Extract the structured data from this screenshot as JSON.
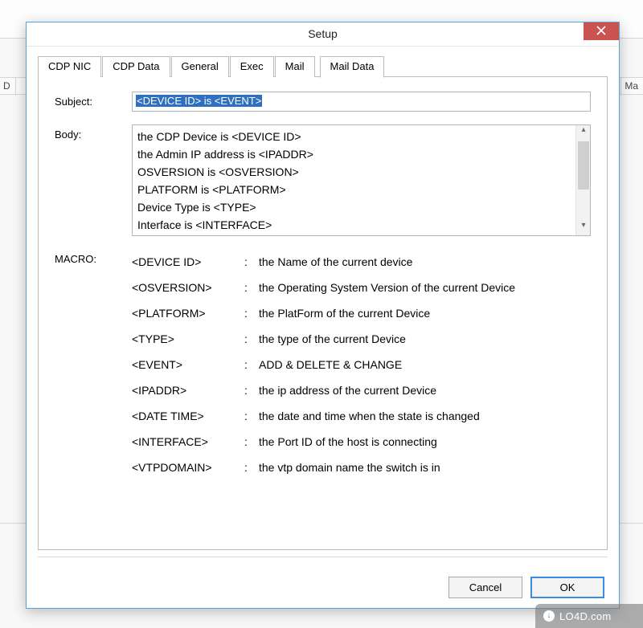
{
  "main_window": {
    "header_left": "D",
    "header_right": "Ma"
  },
  "dialog": {
    "title": "Setup",
    "close_glyph": "✕",
    "tabs": [
      {
        "label": "CDP NIC"
      },
      {
        "label": "CDP Data"
      },
      {
        "label": "General"
      },
      {
        "label": "Exec"
      },
      {
        "label": "Mail"
      },
      {
        "label": "Mail Data"
      }
    ],
    "active_tab_index": 5,
    "subject_label": "Subject:",
    "subject_value": "<DEVICE ID> is <EVENT>",
    "body_label": "Body:",
    "body_value": "the CDP Device is <DEVICE ID>\nthe Admin IP address is <IPADDR>\nOSVERSION is <OSVERSION>\nPLATFORM is <PLATFORM>\nDevice Type is <TYPE>\nInterface is <INTERFACE>",
    "macro_label": "MACRO:",
    "macros": [
      {
        "key": "<DEVICE ID>",
        "desc": "the Name of the current device"
      },
      {
        "key": "<OSVERSION>",
        "desc": "the Operating System Version of the current Device"
      },
      {
        "key": "<PLATFORM>",
        "desc": "the PlatForm of the current Device"
      },
      {
        "key": "<TYPE>",
        "desc": "the type of the current Device"
      },
      {
        "key": "<EVENT>",
        "desc": "ADD & DELETE & CHANGE"
      },
      {
        "key": "<IPADDR>",
        "desc": "the ip address of the current Device"
      },
      {
        "key": "<DATE TIME>",
        "desc": "the date and time when the state is changed"
      },
      {
        "key": "<INTERFACE>",
        "desc": "the Port ID of the host is connecting"
      },
      {
        "key": "<VTPDOMAIN>",
        "desc": "the vtp domain name the switch is in"
      }
    ],
    "buttons": {
      "cancel": "Cancel",
      "ok": "OK"
    }
  },
  "watermark": "LO4D.com"
}
